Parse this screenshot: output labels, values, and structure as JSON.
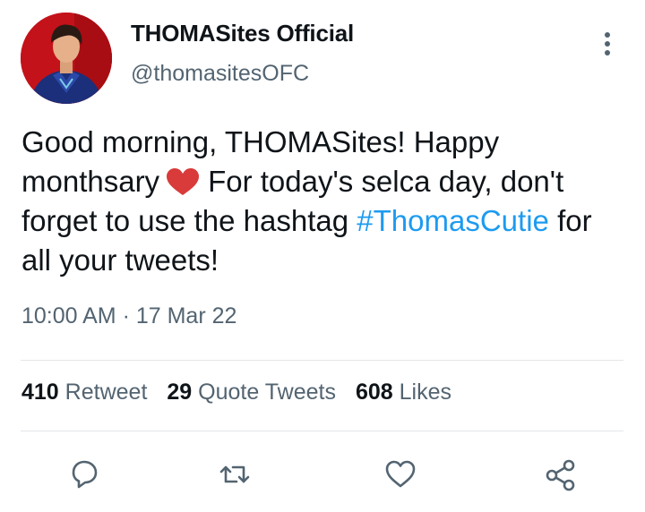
{
  "account": {
    "display_name": "THOMASites Official",
    "handle": "@thomasitesOFC"
  },
  "tweet": {
    "text_part1": "Good morning, THOMASites! Happy monthsary",
    "emoji": "red-heart",
    "text_part2": "For today's selca day, don't forget to use the hashtag",
    "hashtag": "#ThomasCutie",
    "text_part3": "for all your tweets!",
    "timestamp": "10:00 AM · 17 Mar 22"
  },
  "stats": {
    "retweets_count": "410",
    "retweets_label": "Retweet",
    "quotes_count": "29",
    "quotes_label": "Quote Tweets",
    "likes_count": "608",
    "likes_label": "Likes"
  },
  "actions": {
    "reply_icon": "speech-bubble-icon",
    "retweet_icon": "retweet-arrows-icon",
    "like_icon": "heart-outline-icon",
    "share_icon": "share-nodes-icon"
  },
  "colors": {
    "text": "#0f1419",
    "secondary_text": "#536471",
    "link": "#1d9bf0",
    "divider": "#e3e6e8",
    "emoji_heart": "#d93a3a"
  }
}
